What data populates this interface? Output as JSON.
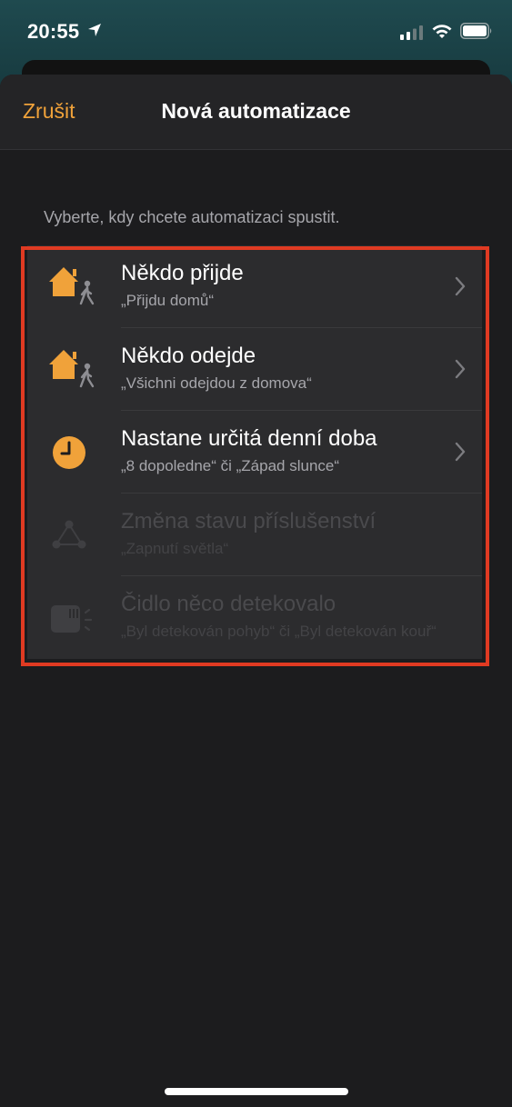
{
  "status_bar": {
    "time": "20:55",
    "icons": [
      "location-arrow-icon",
      "cellular-signal-icon",
      "wifi-icon",
      "battery-icon"
    ]
  },
  "nav": {
    "cancel_label": "Zrušit",
    "title": "Nová automatizace"
  },
  "instruction": "Vyberte, kdy chcete automatizaci spustit.",
  "options": [
    {
      "title": "Někdo přijde",
      "subtitle": "„Přijdu domů“",
      "icon": "person-arrives-home-icon",
      "enabled": true
    },
    {
      "title": "Někdo odejde",
      "subtitle": "„Všichni odejdou z domova“",
      "icon": "person-leaves-home-icon",
      "enabled": true
    },
    {
      "title": "Nastane určitá denní doba",
      "subtitle": "„8 dopoledne“ či „Západ slunce“",
      "icon": "clock-icon",
      "enabled": true
    },
    {
      "title": "Změna stavu příslušenství",
      "subtitle": "„Zapnutí světla“",
      "icon": "accessory-network-icon",
      "enabled": false
    },
    {
      "title": "Čidlo něco detekovalo",
      "subtitle": "„Byl detekován pohyb“ či „Byl detekován kouř“",
      "icon": "sensor-icon",
      "enabled": false
    }
  ],
  "colors": {
    "accent": "#f0a23a",
    "highlight": "#e03a22",
    "background": "#1c1c1e",
    "card": "#2c2c2e"
  }
}
